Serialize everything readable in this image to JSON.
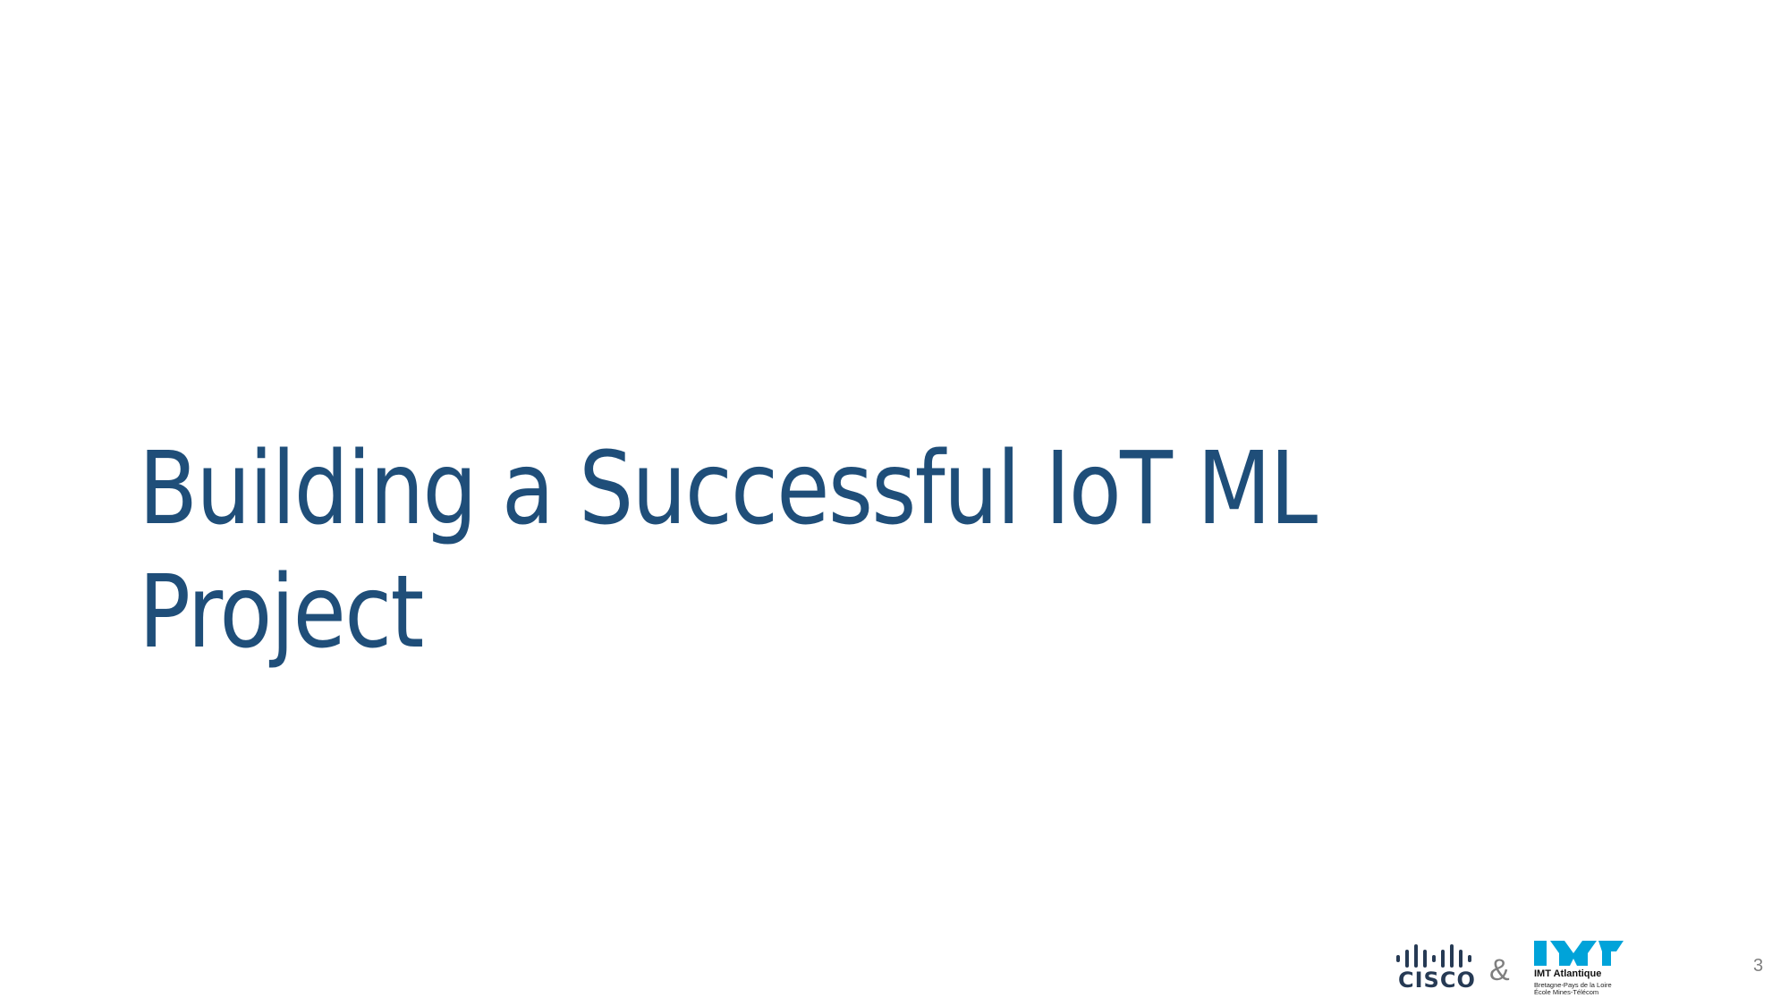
{
  "slide": {
    "title_lines": [
      "Building a Successful IoT ML",
      "Project"
    ],
    "page_number": "3"
  },
  "footer": {
    "cisco_logo": {
      "icon": "cisco-bars-icon",
      "wordmark": "cisco",
      "color": "#263a54"
    },
    "separator": "&",
    "imt_logo": {
      "icon": "imt-mark-icon",
      "name": "IMT Atlantique",
      "subtitle_1": "Bretagne-Pays de la Loire",
      "subtitle_2": "École Mines-Télécom",
      "color": "#00a3d9"
    }
  },
  "colors": {
    "title": "#1f4e79",
    "muted": "#7f7f7f",
    "background": "#ffffff"
  }
}
